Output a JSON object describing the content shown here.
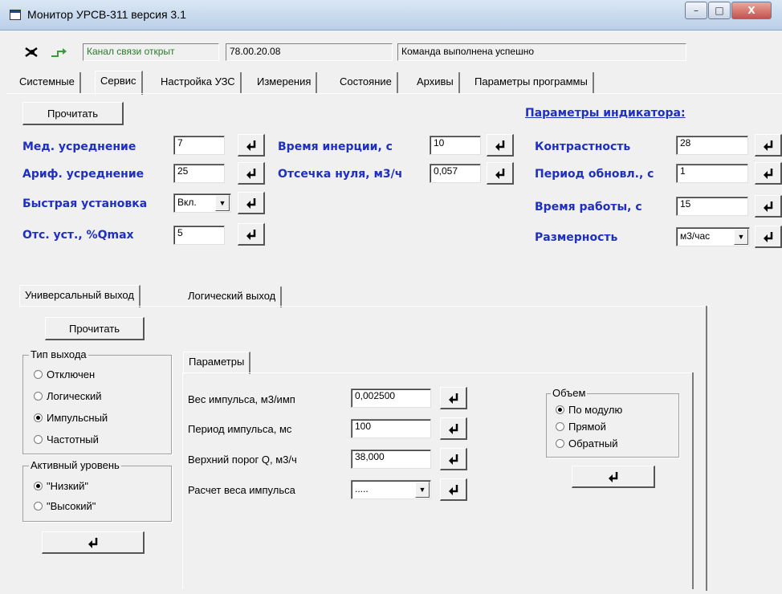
{
  "window": {
    "title": "Монитор УРСВ-311 версия 3.1",
    "min": "–",
    "max": "□",
    "close": "X"
  },
  "status": {
    "channel": "Канал связи открыт",
    "address": "78.00.20.08",
    "message": "Команда выполнена успешно"
  },
  "tabs": [
    {
      "label": "Системные"
    },
    {
      "label": "Сервис"
    },
    {
      "label": "Настройка УЗС"
    },
    {
      "label": "Измерения"
    },
    {
      "label": "Состояние"
    },
    {
      "label": "Архивы"
    },
    {
      "label": "Параметры программы"
    }
  ],
  "service": {
    "read_button": "Прочитать",
    "median_label": "Мед. усреднение",
    "median_value": "7",
    "arith_label": "Ариф. усреднение",
    "arith_value": "25",
    "fast_label": "Быстрая установка",
    "fast_value": "Вкл.",
    "otc_label": "Отс. уст., %Qmax",
    "otc_value": "5",
    "inertia_label": "Время инерции, с",
    "inertia_value": "10",
    "cutoff_label": "Отсечка нуля, м3/ч",
    "cutoff_value": "0,057",
    "indicator_title": "Параметры индикатора:",
    "contrast_label": "Контрастность",
    "contrast_value": "28",
    "period_label": "Период обновл., с",
    "period_value": "1",
    "worktime_label": "Время работы, с",
    "worktime_value": "15",
    "dim_label": "Размерность",
    "dim_value": "м3/час"
  },
  "output_tabs": [
    {
      "label": "Универсальный выход"
    },
    {
      "label": "Логический выход"
    }
  ],
  "output": {
    "read_button": "Прочитать",
    "type_title": "Тип выхода",
    "type_options": [
      "Отключен",
      "Логический",
      "Импульсный",
      "Частотный"
    ],
    "type_selected": "Импульсный",
    "level_title": "Активный уровень",
    "level_options": [
      "\"Низкий\"",
      "\"Высокий\""
    ],
    "level_selected": "\"Низкий\"",
    "params_tab": "Параметры",
    "weight_label": "Вес импульса, м3/имп",
    "weight_value": "0,002500",
    "period_label": "Период импульса, мс",
    "period_value": "100",
    "upper_label": "Верхний порог Q, м3/ч",
    "upper_value": "38,000",
    "calc_label": "Расчет веса импульса",
    "calc_value": ".....",
    "volume_title": "Объем",
    "volume_options": [
      "По модулю",
      "Прямой",
      "Обратный"
    ],
    "volume_selected": "По модулю"
  }
}
